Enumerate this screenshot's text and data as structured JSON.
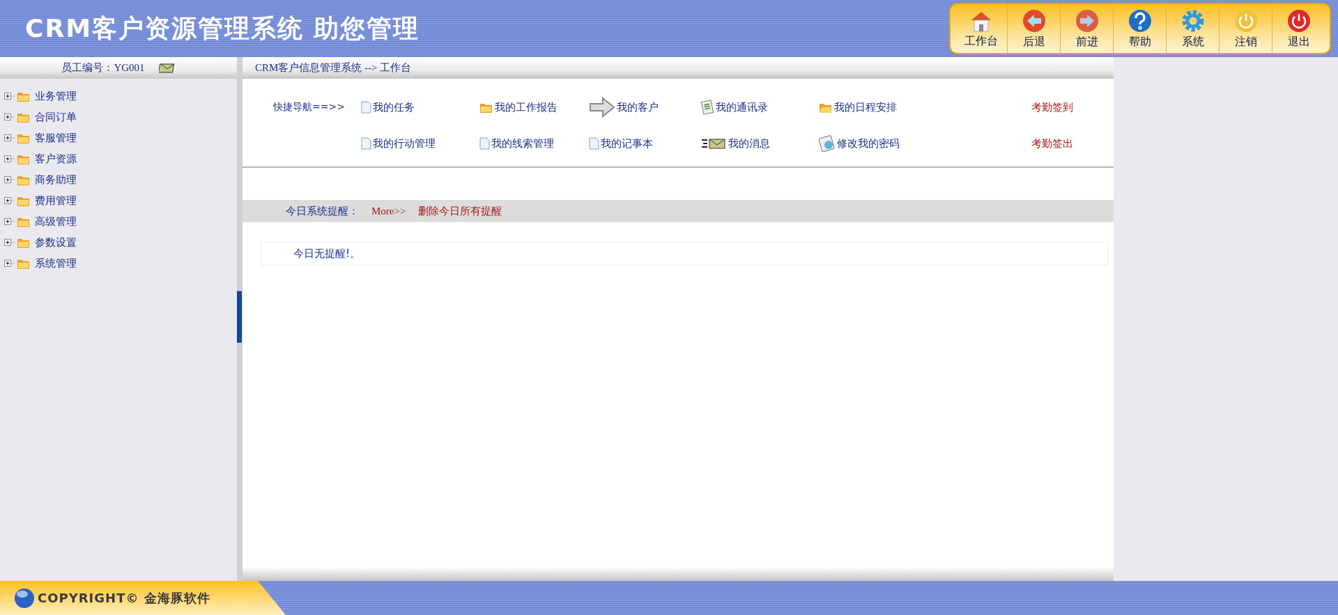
{
  "header": {
    "title": "CRM客户资源管理系统 助您管理"
  },
  "toolbar": [
    {
      "label": "工作台",
      "kind": "home"
    },
    {
      "label": "后退",
      "kind": "back"
    },
    {
      "label": "前进",
      "kind": "forward"
    },
    {
      "label": "帮助",
      "kind": "help"
    },
    {
      "label": "系统",
      "kind": "gear"
    },
    {
      "label": "注销",
      "kind": "logout"
    },
    {
      "label": "退出",
      "kind": "exit"
    }
  ],
  "sidebar": {
    "employee": "员工编号：YG001",
    "tree": [
      {
        "label": "业务管理",
        "expanded": false
      },
      {
        "label": "合同订单",
        "expanded": false
      },
      {
        "label": "客服管理",
        "expanded": false
      },
      {
        "label": "客户资源",
        "expanded": false
      },
      {
        "label": "商务助理",
        "expanded": false
      },
      {
        "label": "费用管理",
        "expanded": false
      },
      {
        "label": "高级管理",
        "expanded": false
      },
      {
        "label": "参数设置",
        "expanded": false
      },
      {
        "label": "系统管理",
        "expanded": false
      }
    ]
  },
  "breadcrumb": "CRM客户信息管理系统 --> 工作台",
  "quick_nav": {
    "label": "快捷导航==>>",
    "rows": [
      {
        "items": [
          {
            "label": "我的任务",
            "kind": "doc"
          },
          {
            "label": "我的工作报告",
            "kind": "folder"
          },
          {
            "label": "我的客户",
            "kind": "arrow"
          },
          {
            "label": "我的通讯录",
            "kind": "list"
          },
          {
            "label": "我的日程安排",
            "kind": "open-folder"
          }
        ],
        "action": "考勤签到"
      },
      {
        "items": [
          {
            "label": "我的行动管理",
            "kind": "doc"
          },
          {
            "label": "我的线索管理",
            "kind": "doc"
          },
          {
            "label": "我的记事本",
            "kind": "doc"
          },
          {
            "label": "我的消息",
            "kind": "mail"
          },
          {
            "label": "修改我的密码",
            "kind": "disc"
          }
        ],
        "action": "考勤签出"
      }
    ]
  },
  "reminders": {
    "label": "今日系统提醒：",
    "more": "More>>",
    "delete_all": "删除今日所有提醒",
    "empty_text": "今日无提醒!。"
  },
  "footer": {
    "copyright": "COPYRIGHT© 金海豚软件"
  }
}
